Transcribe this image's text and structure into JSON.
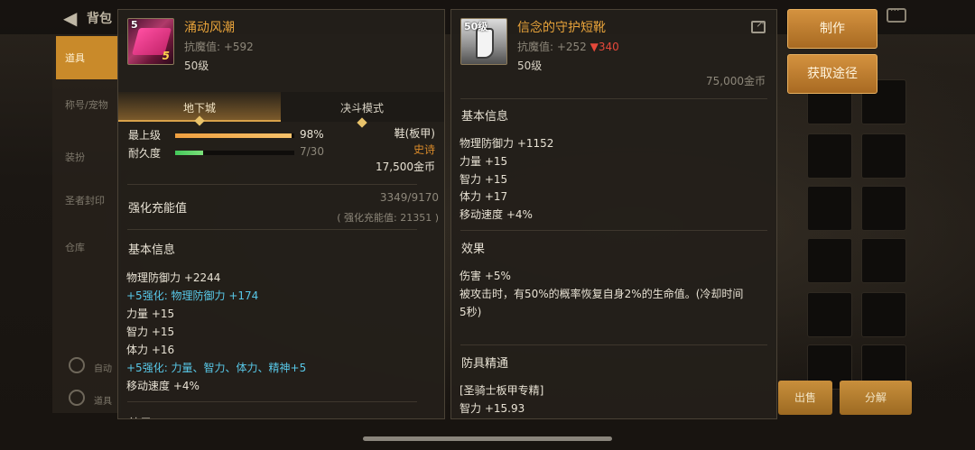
{
  "background": {
    "title": "背包",
    "sidebar_tabs": [
      "道具",
      "称号/宠物",
      "装扮",
      "圣者封印",
      "仓库"
    ],
    "bottom_small": [
      "自动",
      "道具"
    ],
    "buttons": [
      "出售",
      "分解"
    ]
  },
  "item_left": {
    "name": "涌动风潮",
    "resist_label": "抗魔值: +592",
    "level": "50级",
    "icon_level": "5",
    "icon_plus": "5",
    "tabs": [
      "地下城",
      "决斗模式"
    ],
    "bars": [
      {
        "label": "最上级",
        "value_text": "98%",
        "fraction": 0.98,
        "color": "orange"
      },
      {
        "label": "耐久度",
        "value_text": "7/30",
        "fraction": 0.233,
        "color": "green"
      }
    ],
    "slot_type": "鞋(板甲)",
    "rarity": "史诗",
    "price": "17,500金币",
    "charge_title": "强化充能值",
    "charge_value": "3349/9170",
    "charge_sub": "( 强化充能值: 21351 )",
    "basic_title": "基本信息",
    "stats": [
      {
        "text": "物理防御力 +2244",
        "style": ""
      },
      {
        "text": "+5强化: 物理防御力 +174",
        "style": "cyan"
      },
      {
        "text": "力量 +15",
        "style": ""
      },
      {
        "text": "智力 +15",
        "style": ""
      },
      {
        "text": "体力 +16",
        "style": ""
      },
      {
        "text": "+5强化: 力量、智力、体力、精神+5",
        "style": "cyan"
      },
      {
        "text": "移动速度 +4%",
        "style": ""
      }
    ],
    "cut_title": "效果"
  },
  "item_right": {
    "name": "信念的守护短靴",
    "resist_label": "抗魔值: +252",
    "resist_down": "▼340",
    "level": "50级",
    "icon_level": "50级",
    "overflow_text": "75,000金币",
    "basic_title": "基本信息",
    "stats": [
      "物理防御力 +1152",
      "力量 +15",
      "智力 +15",
      "体力 +17",
      "移动速度 +4%"
    ],
    "effect_title": "效果",
    "effects": [
      "伤害 +5%",
      "被攻击时，有50%的概率恢复自身2%的生命值。(冷却时间",
      "5秒)"
    ],
    "mastery_title": "防具精通",
    "mastery": [
      "[圣骑士板甲专精]",
      "智力 +15.93"
    ]
  },
  "actions": {
    "craft": "制作",
    "obtain": "获取途径"
  }
}
